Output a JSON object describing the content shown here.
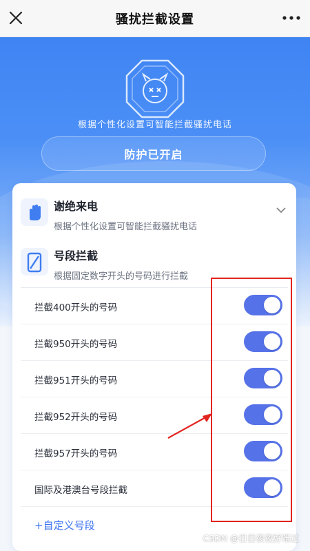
{
  "topbar": {
    "title": "骚扰拦截设置",
    "close_icon": "close-icon",
    "more_icon": "more-dots-icon"
  },
  "hero": {
    "subtitle": "根据个性化设置可智能拦截骚扰电话",
    "status_label": "防护已开启",
    "shield_icon": "shield-robot-icon",
    "colors": {
      "top": "#3f84f3",
      "bottom": "#eaf2fd"
    }
  },
  "features": [
    {
      "title": "谢绝来电",
      "desc": "根据个性化设置可智能拦截骚扰电话",
      "icon": "hand-stop-icon"
    },
    {
      "title": "号段拦截",
      "desc": "根据固定数字开头的号码进行拦截",
      "icon": "phone-slash-icon"
    }
  ],
  "rules": [
    {
      "label": "拦截400开头的号码",
      "enabled": true
    },
    {
      "label": "拦截950开头的号码",
      "enabled": true
    },
    {
      "label": "拦截951开头的号码",
      "enabled": true
    },
    {
      "label": "拦截952开头的号码",
      "enabled": true
    },
    {
      "label": "拦截957开头的号码",
      "enabled": true
    },
    {
      "label": "国际及港澳台号段拦截",
      "enabled": true
    }
  ],
  "add_custom_label": "+自定义号段",
  "toggle_color": "#5672e8",
  "annotation_color": "#e2241f",
  "watermark": "CSDN @日日夜夜好难过"
}
